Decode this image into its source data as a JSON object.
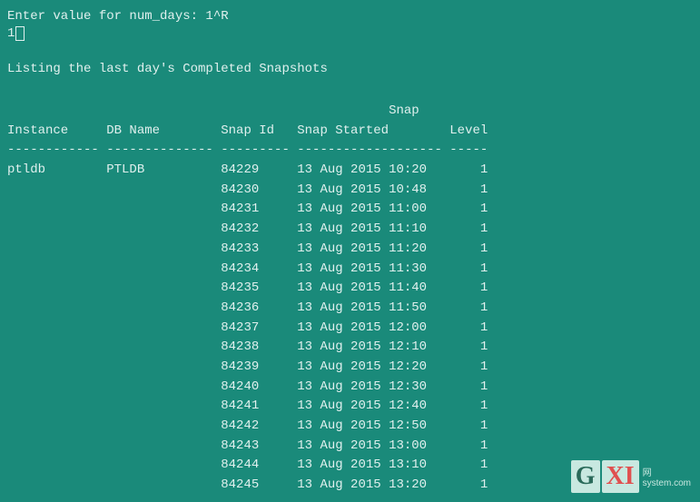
{
  "terminal": {
    "prompt_line": "Enter value for num_days: 1^R",
    "input_value": "1",
    "blank_line": "",
    "listing_line": "Listing the last day's Completed Snapshots",
    "blank_line2": "",
    "header": {
      "snap_label": "Snap",
      "col1": "Instance",
      "col2": "DB Name",
      "col3": "Snap Id",
      "col4": "Snap Started",
      "col5": "Level"
    },
    "divider": "------------ -------------- -------- ------------------- -----",
    "rows": [
      {
        "instance": "ptldb",
        "dbname": "PTLDB",
        "snapid": "84229",
        "date": "13 Aug 2015",
        "time": "10:20",
        "level": "1"
      },
      {
        "instance": "",
        "dbname": "",
        "snapid": "84230",
        "date": "13 Aug 2015",
        "time": "10:48",
        "level": "1"
      },
      {
        "instance": "",
        "dbname": "",
        "snapid": "84231",
        "date": "13 Aug 2015",
        "time": "11:00",
        "level": "1"
      },
      {
        "instance": "",
        "dbname": "",
        "snapid": "84232",
        "date": "13 Aug 2015",
        "time": "11:10",
        "level": "1"
      },
      {
        "instance": "",
        "dbname": "",
        "snapid": "84233",
        "date": "13 Aug 2015",
        "time": "11:20",
        "level": "1"
      },
      {
        "instance": "",
        "dbname": "",
        "snapid": "84234",
        "date": "13 Aug 2015",
        "time": "11:30",
        "level": "1"
      },
      {
        "instance": "",
        "dbname": "",
        "snapid": "84235",
        "date": "13 Aug 2015",
        "time": "11:40",
        "level": "1"
      },
      {
        "instance": "",
        "dbname": "",
        "snapid": "84236",
        "date": "13 Aug 2015",
        "time": "11:50",
        "level": "1"
      },
      {
        "instance": "",
        "dbname": "",
        "snapid": "84237",
        "date": "13 Aug 2015",
        "time": "12:00",
        "level": "1"
      },
      {
        "instance": "",
        "dbname": "",
        "snapid": "84238",
        "date": "13 Aug 2015",
        "time": "12:10",
        "level": "1"
      },
      {
        "instance": "",
        "dbname": "",
        "snapid": "84239",
        "date": "13 Aug 2015",
        "time": "12:20",
        "level": "1"
      },
      {
        "instance": "",
        "dbname": "",
        "snapid": "84240",
        "date": "13 Aug 2015",
        "time": "12:30",
        "level": "1"
      },
      {
        "instance": "",
        "dbname": "",
        "snapid": "84241",
        "date": "13 Aug 2015",
        "time": "12:40",
        "level": "1"
      },
      {
        "instance": "",
        "dbname": "",
        "snapid": "84242",
        "date": "13 Aug 2015",
        "time": "12:50",
        "level": "1"
      },
      {
        "instance": "",
        "dbname": "",
        "snapid": "84243",
        "date": "13 Aug 2015",
        "time": "13:00",
        "level": "1"
      },
      {
        "instance": "",
        "dbname": "",
        "snapid": "84244",
        "date": "13 Aug 2015",
        "time": "13:10",
        "level": "1"
      },
      {
        "instance": "",
        "dbname": "",
        "snapid": "84245",
        "date": "13 Aug 2015",
        "time": "13:20",
        "level": "1"
      }
    ]
  },
  "watermark": {
    "g": "G",
    "xi": "XI",
    "line1": "网",
    "line2": "system.com"
  }
}
